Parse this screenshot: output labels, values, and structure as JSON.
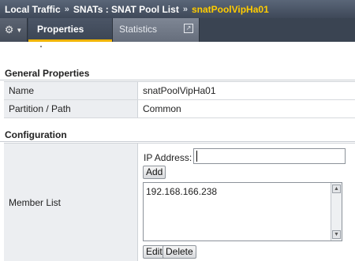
{
  "breadcrumb": {
    "items": [
      "Local Traffic",
      "SNATs : SNAT Pool List",
      "snatPoolVipHa01"
    ],
    "separator": "»"
  },
  "tabs": {
    "gear_icon": "⚙",
    "properties": "Properties",
    "statistics": "Statistics",
    "external_icon": "↗"
  },
  "general": {
    "title": "General Properties",
    "rows": [
      {
        "label": "Name",
        "value": "snatPoolVipHa01"
      },
      {
        "label": "Partition / Path",
        "value": "Common"
      }
    ]
  },
  "configuration": {
    "title": "Configuration",
    "member_list_label": "Member List",
    "ip_address_label": "IP Address:",
    "ip_address_value": "",
    "add_label": "Add",
    "members": [
      "192.168.166.238"
    ],
    "edit_label": "Edit",
    "delete_label": "Delete"
  },
  "colors": {
    "current_crumb": "#ffcc00",
    "header_bg": "#3e4858",
    "active_tab_underline": "#f0b400"
  }
}
